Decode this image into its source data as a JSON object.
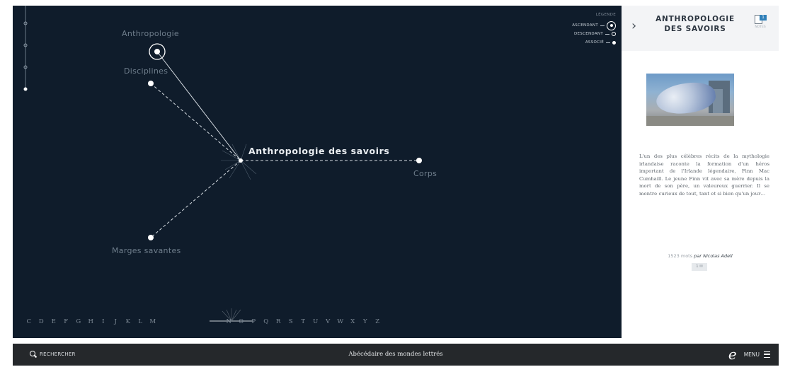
{
  "graph": {
    "nodes": {
      "anthropologie": "Anthropologie",
      "disciplines": "Disciplines",
      "center": "Anthropologie des savoirs",
      "corps": "Corps",
      "marges": "Marges savantes"
    },
    "legend": {
      "title": "LÉGENDE",
      "ascendant": "ASCENDANT",
      "descendant": "DESCENDANT",
      "associe": "ASSOCIÉ"
    },
    "alphabet_before": [
      "C",
      "D",
      "E",
      "F",
      "G",
      "H",
      "I",
      "J",
      "K",
      "L",
      "M"
    ],
    "alphabet_after": [
      "N",
      "O",
      "P",
      "Q",
      "R",
      "S",
      "T",
      "U",
      "V",
      "W",
      "X",
      "Y",
      "Z"
    ]
  },
  "panel": {
    "title_line1": "ANTHROPOLOGIE",
    "title_line2": "DES SAVOIRS",
    "notes_count": "1",
    "notes_label": "NOTES",
    "excerpt": "L'un des plus célèbres récits de la mythologie irlandaise raconte la formation d'un héros important de l'Irlande légendaire, Finn Mac Cumhaill. Le jeune Finn vit avec sa mère depuis la mort de son père, un valeureux guerrier. Il se montre curieux de tout, tant et si bien qu'un jour…",
    "word_count": "1523 mots",
    "by": "par",
    "author": "Nicolas Adell",
    "pill": "1 ✉"
  },
  "bottombar": {
    "search": "RECHERCHER",
    "site_title": "Abécédaire des mondes lettrés",
    "logo": "e",
    "menu": "MENU"
  },
  "colors": {
    "graph_bg": "#0f1c2b",
    "bar_bg": "#25282b",
    "accent": "#2f7fb8"
  }
}
